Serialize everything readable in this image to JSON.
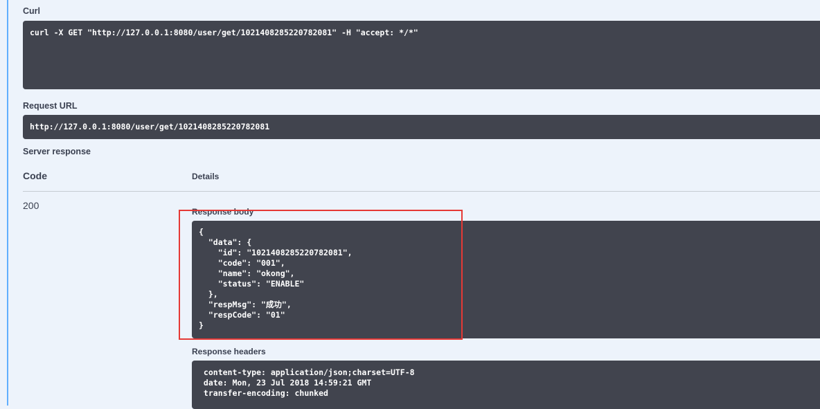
{
  "curl": {
    "label": "Curl",
    "command": "curl -X GET \"http://127.0.0.1:8080/user/get/1021408285220782081\" -H \"accept: */*\""
  },
  "request_url": {
    "label": "Request URL",
    "value": "http://127.0.0.1:8080/user/get/1021408285220782081"
  },
  "server_response": {
    "label": "Server response",
    "code_header": "Code",
    "details_header": "Details",
    "status_code": "200",
    "body_label": "Response body",
    "body": "{\n  \"data\": {\n    \"id\": \"1021408285220782081\",\n    \"code\": \"001\",\n    \"name\": \"okong\",\n    \"status\": \"ENABLE\"\n  },\n  \"respMsg\": \"成功\",\n  \"respCode\": \"01\"\n}",
    "headers_label": "Response headers",
    "headers": " content-type: application/json;charset=UTF-8 \n date: Mon, 23 Jul 2018 14:59:21 GMT \n transfer-encoding: chunked "
  },
  "colors": {
    "page_bg": "#edf3fb",
    "code_bg": "#41444e",
    "accent_border": "#61affe",
    "highlight": "#e53935"
  }
}
